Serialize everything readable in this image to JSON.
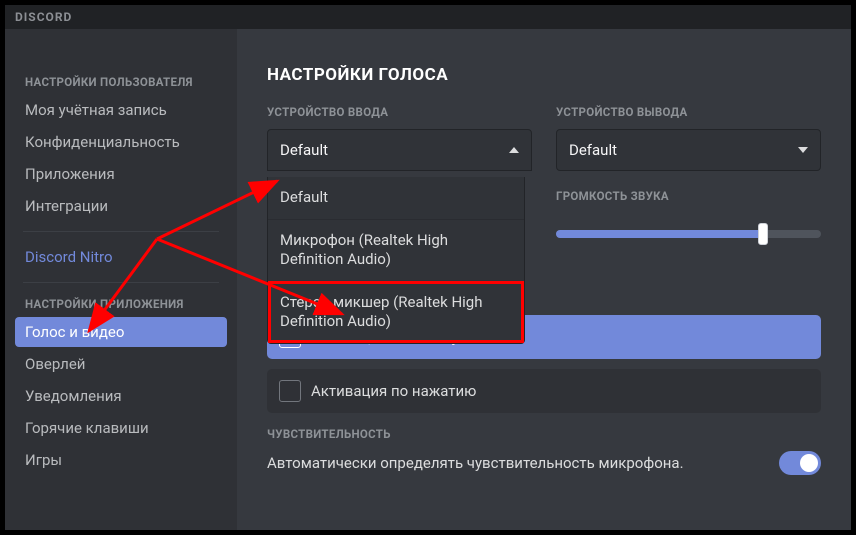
{
  "app_title": "DISCORD",
  "sidebar": {
    "user_settings_label": "НАСТРОЙКИ ПОЛЬЗОВАТЕЛЯ",
    "items_user": [
      "Моя учётная запись",
      "Конфиденциальность",
      "Приложения",
      "Интеграции"
    ],
    "nitro": "Discord Nitro",
    "app_settings_label": "НАСТРОЙКИ ПРИЛОЖЕНИЯ",
    "items_app": [
      "Голос и видео",
      "Оверлей",
      "Уведомления",
      "Горячие клавиши",
      "Игры"
    ],
    "active_index": 0
  },
  "main": {
    "title": "НАСТРОЙКИ ГОЛОСА",
    "input_device_label": "УСТРОЙСТВО ВВОДА",
    "output_device_label": "УСТРОЙСТВО ВЫВОДА",
    "input_selected": "Default",
    "output_selected": "Default",
    "input_options": [
      "Default",
      "Микрофон (Realtek High Definition Audio)",
      "Стерео микшер (Realtek High Definition Audio)"
    ],
    "output_volume_label": "ГРОМКОСТЬ ЗВУКА",
    "output_volume_percent": 78,
    "activation_voice": "Активация по голосу",
    "activation_push": "Активация по нажатию",
    "sensitivity_label": "ЧУВСТВИТЕЛЬНОСТЬ",
    "sensitivity_auto_text": "Автоматически определять чувствительность микрофона.",
    "sensitivity_auto_on": true
  }
}
